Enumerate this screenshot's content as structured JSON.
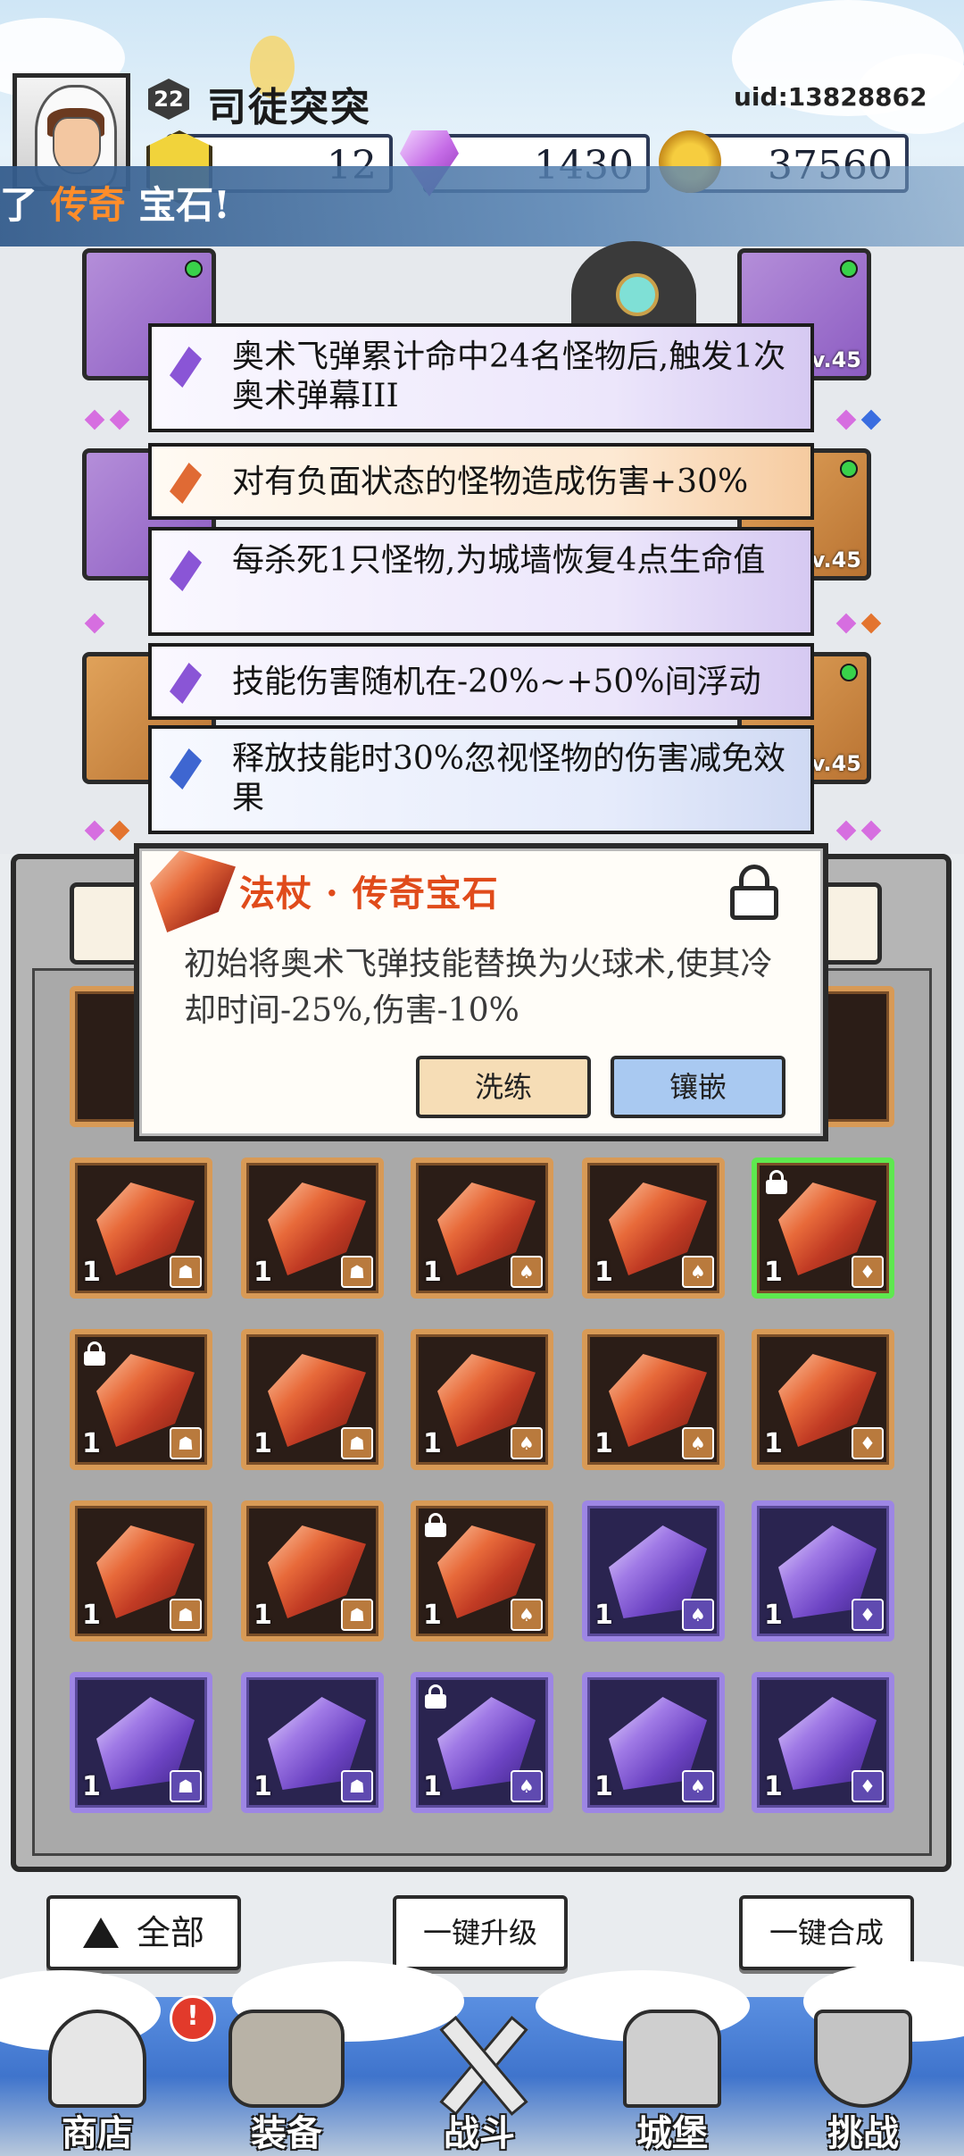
{
  "header": {
    "level": "22",
    "player_name": "司徒突突",
    "uid": "uid:13828862",
    "resources": [
      {
        "name": "yellow-gem",
        "value": "12"
      },
      {
        "name": "purple-diamond",
        "value": "1430"
      },
      {
        "name": "gold-coin",
        "value": "37560"
      }
    ],
    "banner_prefix": "了",
    "banner_highlight": "传奇",
    "banner_suffix": "宝石!"
  },
  "equipment": {
    "level_label": "v.45",
    "affixes": [
      {
        "text": "奥术飞弹累计命中24名怪物后,触发1次奥术弹幕III",
        "color": "purple"
      },
      {
        "text": "对有负面状态的怪物造成伤害+30%",
        "color": "orange"
      },
      {
        "text": "每杀死1只怪物,为城墙恢复4点生命值",
        "color": "purple"
      },
      {
        "text": "技能伤害随机在-20%~+50%间浮动",
        "color": "purple"
      },
      {
        "text": "释放技能时30%忽视怪物的伤害减免效果",
        "color": "blue"
      }
    ]
  },
  "popup": {
    "title": "法杖 · 传奇宝石",
    "description": "初始将奥术飞弹技能替换为火球术,使其冷却时间-25%,伤害-10%",
    "refine_label": "洗练",
    "inlay_label": "镶嵌"
  },
  "inventory": {
    "count_label": "1",
    "rows": [
      [
        {
          "type": "orange",
          "lock": false,
          "sel": false
        },
        {
          "type": "orange",
          "lock": false,
          "sel": false
        },
        {
          "type": "orange",
          "lock": false,
          "sel": false
        },
        {
          "type": "orange",
          "lock": false,
          "sel": false
        },
        {
          "type": "orange",
          "lock": true,
          "sel": true
        }
      ],
      [
        {
          "type": "orange",
          "lock": true,
          "sel": false
        },
        {
          "type": "orange",
          "lock": false,
          "sel": false
        },
        {
          "type": "orange",
          "lock": false,
          "sel": false
        },
        {
          "type": "orange",
          "lock": false,
          "sel": false
        },
        {
          "type": "orange",
          "lock": false,
          "sel": false
        }
      ],
      [
        {
          "type": "orange",
          "lock": false,
          "sel": false
        },
        {
          "type": "orange",
          "lock": false,
          "sel": false
        },
        {
          "type": "orange",
          "lock": true,
          "sel": false
        },
        {
          "type": "purple",
          "lock": false,
          "sel": false
        },
        {
          "type": "purple",
          "lock": false,
          "sel": false
        }
      ],
      [
        {
          "type": "purple",
          "lock": false,
          "sel": false
        },
        {
          "type": "purple",
          "lock": false,
          "sel": false
        },
        {
          "type": "purple",
          "lock": true,
          "sel": false
        },
        {
          "type": "purple",
          "lock": false,
          "sel": false
        },
        {
          "type": "purple",
          "lock": false,
          "sel": false
        }
      ]
    ]
  },
  "actions": {
    "all_label": "全部",
    "upgrade_label": "一键升级",
    "merge_label": "一键合成"
  },
  "nav": {
    "badge": "!",
    "items": [
      "商店",
      "装备",
      "战斗",
      "城堡",
      "挑战"
    ]
  },
  "colors": {
    "legendary_title": "#e04b1b",
    "banner_highlight": "#ff8d2a",
    "selected_border": "#5ee84f"
  }
}
